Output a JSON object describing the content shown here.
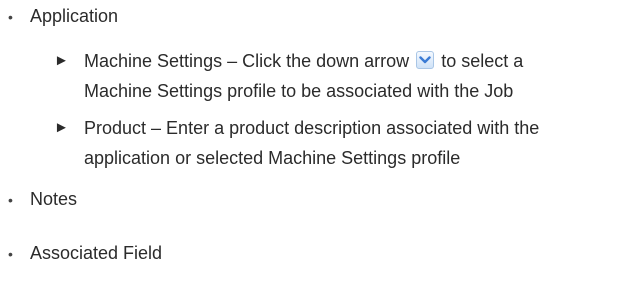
{
  "bullets": {
    "application": "Application",
    "notes": "Notes",
    "associated_field": "Associated Field"
  },
  "sub_items": {
    "machine_settings": {
      "arrow_glyph": "►",
      "line1_before_icon": "Machine Settings – Click the down arrow",
      "line1_after_icon": "to select a",
      "line2": "Machine Settings profile to be associated with the Job"
    },
    "product": {
      "arrow_glyph": "►",
      "line1": "Product – Enter a product description associated with the",
      "line2": "application or selected Machine Settings profile"
    }
  },
  "bullet_glyph": "•",
  "icons": {
    "dropdown": "chevron-down-icon",
    "dropdown_color": "#3a7bd5"
  }
}
